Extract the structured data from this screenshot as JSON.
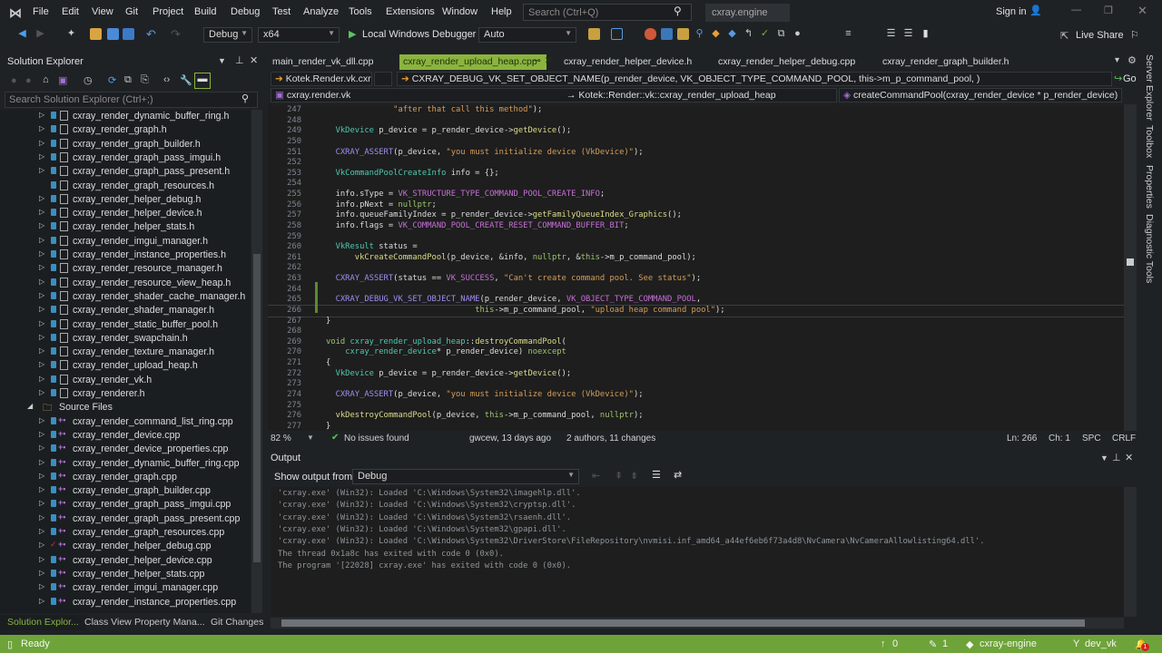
{
  "menu": [
    "File",
    "Edit",
    "View",
    "Git",
    "Project",
    "Build",
    "Debug",
    "Test",
    "Analyze",
    "Tools",
    "Extensions",
    "Window",
    "Help"
  ],
  "search_placeholder": "Search (Ctrl+Q)",
  "solution_name": "cxray.engine",
  "sign_in": "Sign in",
  "toolbar": {
    "config": "Debug",
    "platform": "x64",
    "debugger": "Local Windows Debugger",
    "auto": "Auto",
    "live_share": "Live Share"
  },
  "solution_explorer": {
    "title": "Solution Explorer",
    "search_placeholder": "Search Solution Explorer (Ctrl+;)",
    "items": [
      {
        "label": "cxray_render_dynamic_buffer_ring.h",
        "kind": "h",
        "exp": true
      },
      {
        "label": "cxray_render_graph.h",
        "kind": "h",
        "exp": true
      },
      {
        "label": "cxray_render_graph_builder.h",
        "kind": "h",
        "exp": true
      },
      {
        "label": "cxray_render_graph_pass_imgui.h",
        "kind": "h",
        "exp": true
      },
      {
        "label": "cxray_render_graph_pass_present.h",
        "kind": "h",
        "exp": true
      },
      {
        "label": "cxray_render_graph_resources.h",
        "kind": "h",
        "exp": false
      },
      {
        "label": "cxray_render_helper_debug.h",
        "kind": "h",
        "exp": true
      },
      {
        "label": "cxray_render_helper_device.h",
        "kind": "h",
        "exp": true
      },
      {
        "label": "cxray_render_helper_stats.h",
        "kind": "h",
        "exp": true
      },
      {
        "label": "cxray_render_imgui_manager.h",
        "kind": "h",
        "exp": true
      },
      {
        "label": "cxray_render_instance_properties.h",
        "kind": "h",
        "exp": true
      },
      {
        "label": "cxray_render_resource_manager.h",
        "kind": "h",
        "exp": true
      },
      {
        "label": "cxray_render_resource_view_heap.h",
        "kind": "h",
        "exp": true
      },
      {
        "label": "cxray_render_shader_cache_manager.h",
        "kind": "h",
        "exp": true
      },
      {
        "label": "cxray_render_shader_manager.h",
        "kind": "h",
        "exp": true
      },
      {
        "label": "cxray_render_static_buffer_pool.h",
        "kind": "h",
        "exp": true
      },
      {
        "label": "cxray_render_swapchain.h",
        "kind": "h",
        "exp": true
      },
      {
        "label": "cxray_render_texture_manager.h",
        "kind": "h",
        "exp": true
      },
      {
        "label": "cxray_render_upload_heap.h",
        "kind": "h",
        "exp": true
      },
      {
        "label": "cxray_render_vk.h",
        "kind": "h",
        "exp": true
      },
      {
        "label": "cxray_renderer.h",
        "kind": "h",
        "exp": true
      },
      {
        "label": "Source Files",
        "kind": "folder",
        "exp": true
      },
      {
        "label": "cxray_render_command_list_ring.cpp",
        "kind": "cpp",
        "exp": true
      },
      {
        "label": "cxray_render_device.cpp",
        "kind": "cpp",
        "exp": true
      },
      {
        "label": "cxray_render_device_properties.cpp",
        "kind": "cpp",
        "exp": true
      },
      {
        "label": "cxray_render_dynamic_buffer_ring.cpp",
        "kind": "cpp",
        "exp": true
      },
      {
        "label": "cxray_render_graph.cpp",
        "kind": "cpp",
        "exp": true
      },
      {
        "label": "cxray_render_graph_builder.cpp",
        "kind": "cpp",
        "exp": true
      },
      {
        "label": "cxray_render_graph_pass_imgui.cpp",
        "kind": "cpp",
        "exp": true
      },
      {
        "label": "cxray_render_graph_pass_present.cpp",
        "kind": "cpp",
        "exp": true
      },
      {
        "label": "cxray_render_graph_resources.cpp",
        "kind": "cpp",
        "exp": true
      },
      {
        "label": "cxray_render_helper_debug.cpp",
        "kind": "cpp",
        "exp": true,
        "modified": true
      },
      {
        "label": "cxray_render_helper_device.cpp",
        "kind": "cpp",
        "exp": true
      },
      {
        "label": "cxray_render_helper_stats.cpp",
        "kind": "cpp",
        "exp": true
      },
      {
        "label": "cxray_render_imgui_manager.cpp",
        "kind": "cpp",
        "exp": true
      },
      {
        "label": "cxray_render_instance_properties.cpp",
        "kind": "cpp",
        "exp": true
      }
    ],
    "bottom_tabs": [
      "Solution Explor...",
      "Class View",
      "Property Mana...",
      "Git Changes"
    ]
  },
  "editor": {
    "tabs": [
      "main_render_vk_dll.cpp",
      "cxray_render_upload_heap.cpp",
      "cxray_render_helper_device.h",
      "cxray_render_helper_debug.cpp",
      "cxray_render_graph_builder.h"
    ],
    "nav_project": "Kotek.Render.vk.cxray",
    "nav_symbol": "CXRAY_DEBUG_VK_SET_OBJECT_NAME(p_render_device, VK_OBJECT_TYPE_COMMAND_POOL, this->m_p_command_pool, )",
    "go": "Go",
    "nav_file": "cxray.render.vk",
    "nav_scope": "Kotek::Render::vk::cxray_render_upload_heap",
    "nav_member": "createCommandPool(cxray_render_device * p_render_device)",
    "lines": [
      {
        "n": "247",
        "tokens": [
          [
            "p",
            "              "
          ],
          [
            "s",
            "\"after that call this method\""
          ],
          [
            "p",
            ");"
          ]
        ]
      },
      {
        "n": "248",
        "tokens": []
      },
      {
        "n": "249",
        "tokens": [
          [
            "p",
            "  "
          ],
          [
            "t",
            "VkDevice"
          ],
          [
            "p",
            " p_device = p_render_device->"
          ],
          [
            "f",
            "getDevice"
          ],
          [
            "p",
            "();"
          ]
        ]
      },
      {
        "n": "250",
        "tokens": []
      },
      {
        "n": "251",
        "tokens": [
          [
            "p",
            "  "
          ],
          [
            "m",
            "CXRAY_ASSERT"
          ],
          [
            "p",
            "(p_device, "
          ],
          [
            "s",
            "\"you must initialize device (VkDevice)\""
          ],
          [
            "p",
            ");"
          ]
        ]
      },
      {
        "n": "252",
        "tokens": []
      },
      {
        "n": "253",
        "tokens": [
          [
            "p",
            "  "
          ],
          [
            "t",
            "VkCommandPoolCreateInfo"
          ],
          [
            "p",
            " info = {};"
          ]
        ]
      },
      {
        "n": "254",
        "tokens": []
      },
      {
        "n": "255",
        "tokens": [
          [
            "p",
            "  info.sType = "
          ],
          [
            "e",
            "VK_STRUCTURE_TYPE_COMMAND_POOL_CREATE_INFO"
          ],
          [
            "p",
            ";"
          ]
        ]
      },
      {
        "n": "256",
        "tokens": [
          [
            "p",
            "  info.pNext = "
          ],
          [
            "k",
            "nullptr"
          ],
          [
            "p",
            ";"
          ]
        ]
      },
      {
        "n": "257",
        "tokens": [
          [
            "p",
            "  info.queueFamilyIndex = p_render_device->"
          ],
          [
            "f",
            "getFamilyQueueIndex_Graphics"
          ],
          [
            "p",
            "();"
          ]
        ]
      },
      {
        "n": "258",
        "tokens": [
          [
            "p",
            "  info.flags = "
          ],
          [
            "e",
            "VK_COMMAND_POOL_CREATE_RESET_COMMAND_BUFFER_BIT"
          ],
          [
            "p",
            ";"
          ]
        ]
      },
      {
        "n": "259",
        "tokens": []
      },
      {
        "n": "260",
        "tokens": [
          [
            "p",
            "  "
          ],
          [
            "t",
            "VkResult"
          ],
          [
            "p",
            " status ="
          ]
        ]
      },
      {
        "n": "261",
        "tokens": [
          [
            "p",
            "      "
          ],
          [
            "f",
            "vkCreateCommandPool"
          ],
          [
            "p",
            "(p_device, &info, "
          ],
          [
            "k",
            "nullptr"
          ],
          [
            "p",
            ", &"
          ],
          [
            "k",
            "this"
          ],
          [
            "p",
            "->m_p_command_pool);"
          ]
        ]
      },
      {
        "n": "262",
        "tokens": []
      },
      {
        "n": "263",
        "tokens": [
          [
            "p",
            "  "
          ],
          [
            "m",
            "CXRAY_ASSERT"
          ],
          [
            "p",
            "(status == "
          ],
          [
            "e",
            "VK_SUCCESS"
          ],
          [
            "p",
            ", "
          ],
          [
            "s",
            "\"Can't create command pool. See status\""
          ],
          [
            "p",
            ");"
          ]
        ]
      },
      {
        "n": "264",
        "tokens": []
      },
      {
        "n": "265",
        "tokens": [
          [
            "p",
            "  "
          ],
          [
            "m",
            "CXRAY_DEBUG_VK_SET_OBJECT_NAME"
          ],
          [
            "p",
            "(p_render_device, "
          ],
          [
            "e",
            "VK_OBJECT_TYPE_COMMAND_POOL"
          ],
          [
            "p",
            ","
          ]
        ]
      },
      {
        "n": "266",
        "tokens": [
          [
            "p",
            "                               "
          ],
          [
            "k",
            "this"
          ],
          [
            "p",
            "->m_p_command_pool, "
          ],
          [
            "s",
            "\"upload heap command pool\""
          ],
          [
            "p",
            ");"
          ]
        ],
        "current": true
      },
      {
        "n": "267",
        "tokens": [
          [
            "p",
            "}"
          ]
        ]
      },
      {
        "n": "268",
        "tokens": []
      },
      {
        "n": "269",
        "tokens": [
          [
            "k",
            "void"
          ],
          [
            "p",
            " "
          ],
          [
            "c",
            "cxray_render_upload_heap"
          ],
          [
            "p",
            "::"
          ],
          [
            "f",
            "destroyCommandPool"
          ],
          [
            "p",
            "("
          ]
        ]
      },
      {
        "n": "270",
        "tokens": [
          [
            "p",
            "    "
          ],
          [
            "c",
            "cxray_render_device"
          ],
          [
            "p",
            "* p_render_device) "
          ],
          [
            "k",
            "noexcept"
          ]
        ]
      },
      {
        "n": "271",
        "tokens": [
          [
            "p",
            "{"
          ]
        ]
      },
      {
        "n": "272",
        "tokens": [
          [
            "p",
            "  "
          ],
          [
            "t",
            "VkDevice"
          ],
          [
            "p",
            " p_device = p_render_device->"
          ],
          [
            "f",
            "getDevice"
          ],
          [
            "p",
            "();"
          ]
        ]
      },
      {
        "n": "273",
        "tokens": []
      },
      {
        "n": "274",
        "tokens": [
          [
            "p",
            "  "
          ],
          [
            "m",
            "CXRAY_ASSERT"
          ],
          [
            "p",
            "(p_device, "
          ],
          [
            "s",
            "\"you must initialize device (VkDevice)\""
          ],
          [
            "p",
            ");"
          ]
        ]
      },
      {
        "n": "275",
        "tokens": []
      },
      {
        "n": "276",
        "tokens": [
          [
            "p",
            "  "
          ],
          [
            "f",
            "vkDestroyCommandPool"
          ],
          [
            "p",
            "(p_device, "
          ],
          [
            "k",
            "this"
          ],
          [
            "p",
            "->m_p_command_pool, "
          ],
          [
            "k",
            "nullptr"
          ],
          [
            "p",
            ");"
          ]
        ]
      },
      {
        "n": "277",
        "tokens": [
          [
            "p",
            "}"
          ]
        ]
      }
    ],
    "status": {
      "zoom": "82 %",
      "issues": "No issues found",
      "blame": "gwcew, 13 days ago",
      "authors": "2 authors, 11 changes",
      "ln": "Ln: 266",
      "ch": "Ch: 1",
      "spc": "SPC",
      "crlf": "CRLF"
    }
  },
  "output": {
    "title": "Output",
    "show_from_label": "Show output from:",
    "source": "Debug",
    "lines": [
      "'cxray.exe' (Win32): Loaded 'C:\\Windows\\System32\\imagehlp.dll'.",
      "'cxray.exe' (Win32): Loaded 'C:\\Windows\\System32\\cryptsp.dll'.",
      "'cxray.exe' (Win32): Loaded 'C:\\Windows\\System32\\rsaenh.dll'.",
      "'cxray.exe' (Win32): Loaded 'C:\\Windows\\System32\\gpapi.dll'.",
      "'cxray.exe' (Win32): Loaded 'C:\\Windows\\System32\\DriverStore\\FileRepository\\nvmisi.inf_amd64_a44ef6eb6f73a4d8\\NvCamera\\NvCameraAllowlisting64.dll'.",
      "The thread 0x1a8c has exited with code 0 (0x0).",
      "The program '[22028] cxray.exe' has exited with code 0 (0x0)."
    ]
  },
  "right_rail": [
    "Server Explorer",
    "Toolbox",
    "Properties",
    "Diagnostic Tools"
  ],
  "statusbar": {
    "ready": "Ready",
    "up": "0",
    "pencil": "1",
    "repo": "cxray-engine",
    "branch": "dev_vk",
    "notifications": "1"
  },
  "colors": {
    "accent": "#8ab43e",
    "statusbar": "#6ea33a"
  }
}
